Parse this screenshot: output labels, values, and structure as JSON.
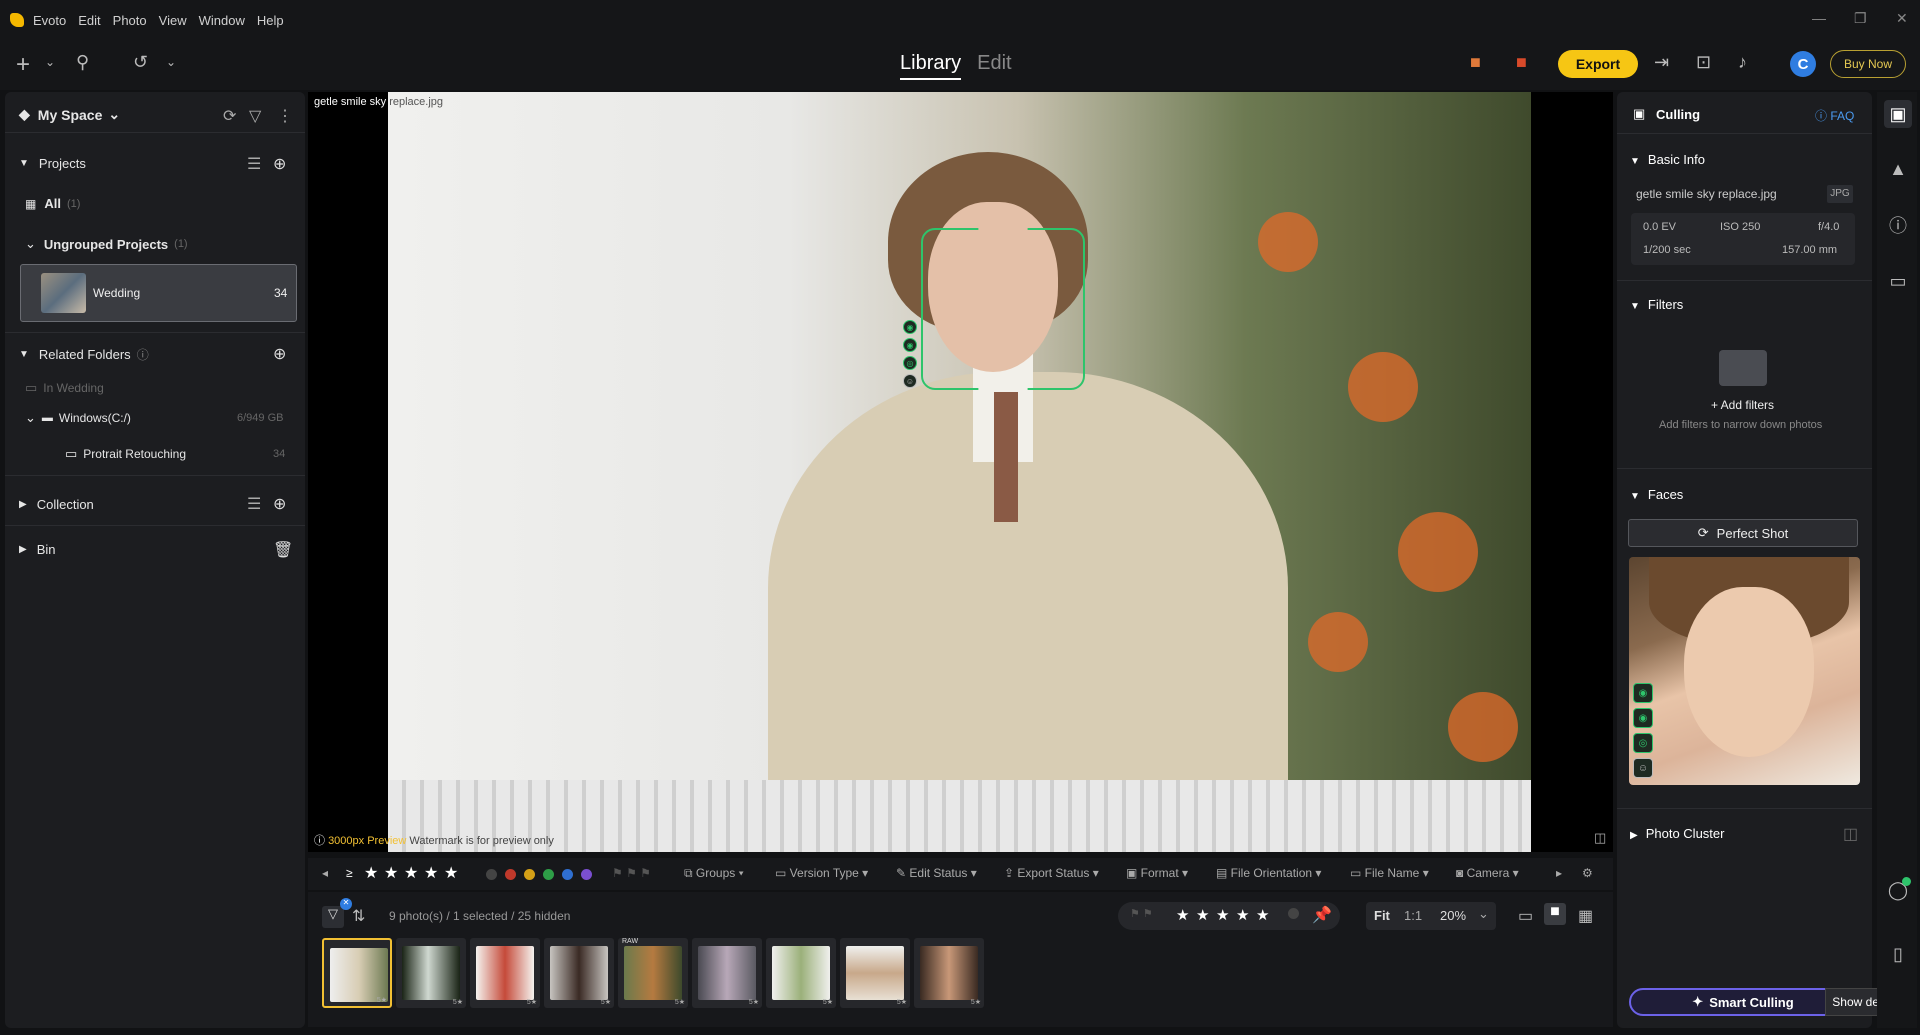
{
  "menu": {
    "items": [
      "Evoto",
      "Edit",
      "Photo",
      "View",
      "Window",
      "Help"
    ]
  },
  "header": {
    "tabs": [
      {
        "label": "Library"
      },
      {
        "label": "Edit"
      }
    ],
    "export_label": "Export",
    "buy_label": "Buy Now",
    "avatar_letter": "C"
  },
  "sidebar": {
    "space_label": "My Space",
    "projects_label": "Projects",
    "all_label": "All",
    "all_count": "(1)",
    "ungrouped_label": "Ungrouped Projects",
    "ungrouped_count": "(1)",
    "project": {
      "name": "Wedding",
      "count": "34"
    },
    "related_label": "Related Folders",
    "in_wedding": "In Wedding",
    "drive": {
      "name": "Windows(C:/)",
      "size": "6/949 GB"
    },
    "folder": {
      "name": "Protrait Retouching",
      "count": "34"
    },
    "collection_label": "Collection",
    "bin_label": "Bin"
  },
  "viewer": {
    "filename": "getle smile sky",
    "filename_dim": "replace.jpg",
    "preview_note": "3000px Preview",
    "preview_dim": "Watermark is for preview only"
  },
  "filterbar": {
    "ge": "≥",
    "groups": "Groups",
    "version_type": "Version Type",
    "edit_status": "Edit Status",
    "export_status": "Export Status",
    "format": "Format",
    "orientation": "File Orientation",
    "file_name": "File Name",
    "camera": "Camera",
    "label_colors": [
      "#444",
      "#c0392b",
      "#d4a017",
      "#2e9e47",
      "#2f6fd1",
      "#7a4fd0"
    ]
  },
  "status": {
    "text": "9 photo(s) / 1 selected / 25 hidden"
  },
  "zoom": {
    "fit": "Fit",
    "one": "1:1",
    "value": "20%"
  },
  "filmstrip": [
    {
      "badge": "5★",
      "selected": true,
      "raw": ""
    },
    {
      "badge": "5★",
      "selected": false,
      "raw": ""
    },
    {
      "badge": "5★",
      "selected": false,
      "raw": ""
    },
    {
      "badge": "5★",
      "selected": false,
      "raw": ""
    },
    {
      "badge": "5★",
      "selected": false,
      "raw": "RAW"
    },
    {
      "badge": "5★",
      "selected": false,
      "raw": ""
    },
    {
      "badge": "5★",
      "selected": false,
      "raw": ""
    },
    {
      "badge": "5★",
      "selected": false,
      "raw": ""
    },
    {
      "badge": "5★",
      "selected": false,
      "raw": ""
    }
  ],
  "right": {
    "culling_label": "Culling",
    "faq_label": "FAQ",
    "basic_info_label": "Basic Info",
    "file": "getle smile sky replace.jpg",
    "format": "JPG",
    "ev": "0.0 EV",
    "iso": "ISO 250",
    "aperture": "f/4.0",
    "shutter": "1/200 sec",
    "focal": "157.00 mm",
    "filters_label": "Filters",
    "add_filters": "+ Add filters",
    "add_filters_hint": "Add filters to narrow down photos",
    "faces_label": "Faces",
    "perfect_shot": "Perfect Shot",
    "cluster_label": "Photo Cluster",
    "smart_culling": "Smart Culling",
    "tooltip": "Show desktop"
  }
}
